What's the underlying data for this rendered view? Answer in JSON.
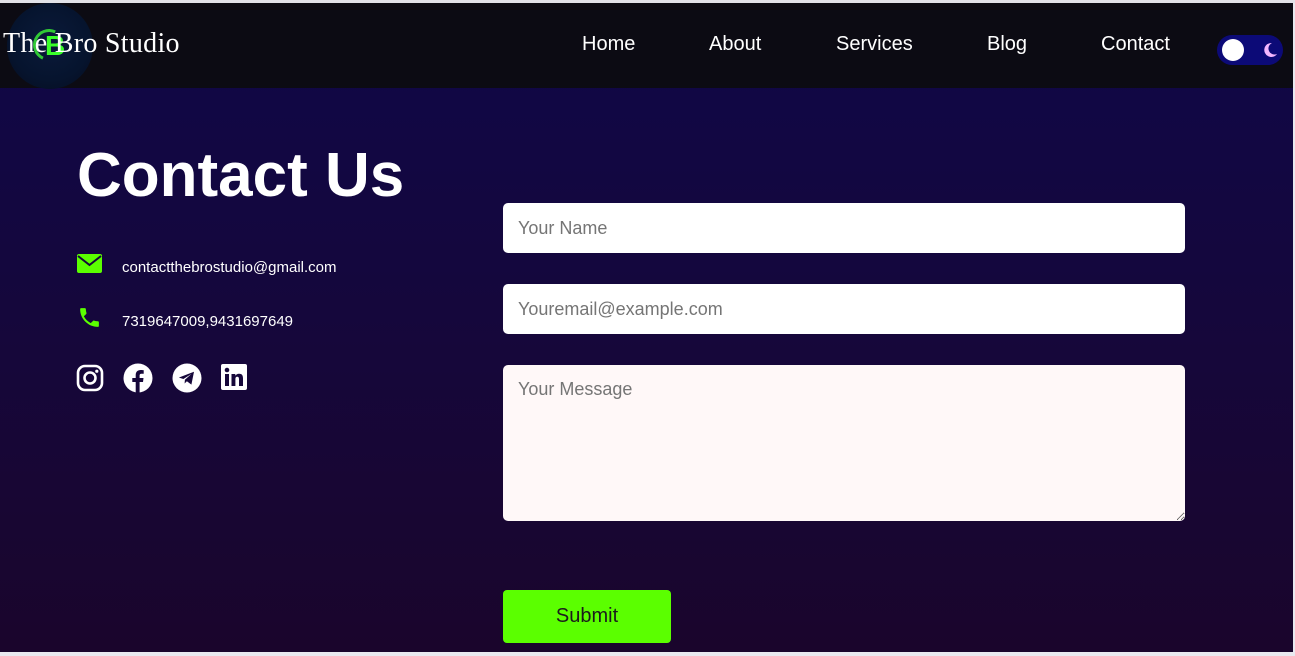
{
  "brand": {
    "name": "The Bro Studio",
    "logo_letter": "B"
  },
  "nav": {
    "items": [
      {
        "label": "Home"
      },
      {
        "label": "About"
      },
      {
        "label": "Services"
      },
      {
        "label": "Blog"
      },
      {
        "label": "Contact"
      }
    ],
    "theme_toggle_icons": [
      "sun-knob",
      "moon-icon"
    ]
  },
  "contact": {
    "title": "Contact Us",
    "email": "contactthebrostudio@gmail.com",
    "phone": "7319647009,9431697649",
    "social": [
      "instagram-icon",
      "facebook-icon",
      "telegram-icon",
      "linkedin-icon"
    ]
  },
  "form": {
    "name_placeholder": "Your Name",
    "email_placeholder": "Youremail@example.com",
    "message_placeholder": "Your Message",
    "submit_label": "Submit"
  },
  "colors": {
    "accent": "#5bff00",
    "navbar": "#0c0b13",
    "background_top": "#0f0748",
    "background_bottom": "#1a052c",
    "toggle": "#0c0a77"
  }
}
